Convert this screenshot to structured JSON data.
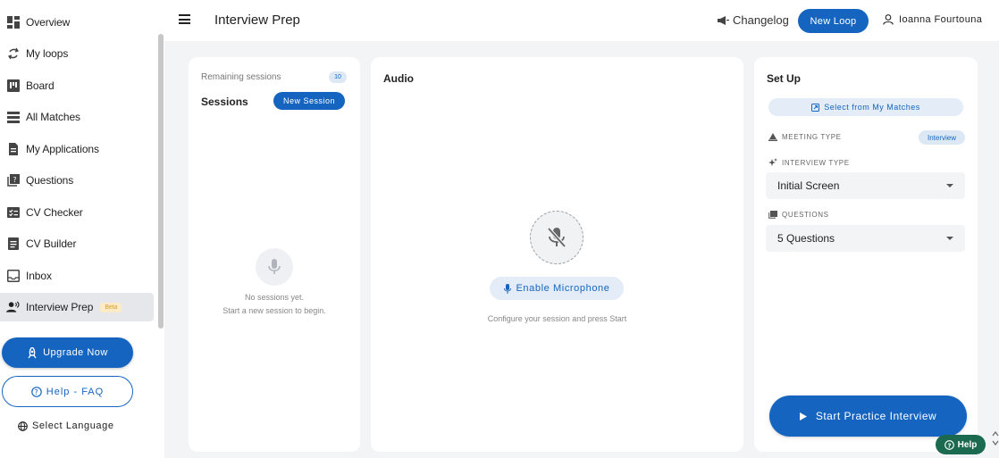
{
  "sidebar": {
    "items": [
      {
        "label": "Overview",
        "icon": "dashboard-icon"
      },
      {
        "label": "My loops",
        "icon": "loop-icon"
      },
      {
        "label": "Board",
        "icon": "board-icon"
      },
      {
        "label": "All Matches",
        "icon": "list-icon"
      },
      {
        "label": "My Applications",
        "icon": "document-icon"
      },
      {
        "label": "Questions",
        "icon": "quiz-icon"
      },
      {
        "label": "CV Checker",
        "icon": "checklist-icon"
      },
      {
        "label": "CV Builder",
        "icon": "document-icon"
      },
      {
        "label": "Inbox",
        "icon": "inbox-icon"
      },
      {
        "label": "Interview Prep",
        "icon": "person-voice-icon",
        "badge": "Beta",
        "active": true
      }
    ],
    "upgrade_label": "Upgrade Now",
    "help_label": "Help - FAQ",
    "language_label": "Select Language"
  },
  "header": {
    "title": "Interview Prep",
    "changelog_label": "Changelog",
    "new_loop_label": "New Loop",
    "user_name": "Ioanna Fourtouna"
  },
  "sessions": {
    "remaining_label": "Remaining sessions",
    "remaining_count": "10",
    "title": "Sessions",
    "new_session_label": "New Session",
    "empty_line1": "No sessions yet.",
    "empty_line2": "Start a new session to begin."
  },
  "audio": {
    "title": "Audio",
    "enable_label": "Enable Microphone",
    "hint": "Configure your session and press Start"
  },
  "setup": {
    "title": "Set Up",
    "select_matches_label": "Select from My Matches",
    "meeting_type_label": "MEETING TYPE",
    "meeting_type_value": "Interview",
    "interview_type_label": "INTERVIEW TYPE",
    "interview_type_value": "Initial Screen",
    "questions_label": "QUESTIONS",
    "questions_value": "5 Questions",
    "start_label": "Start Practice Interview"
  },
  "help_widget": {
    "label": "Help"
  },
  "colors": {
    "accent": "#1565c0",
    "help_green": "#1b6a4f",
    "beta": "#d69e2e"
  }
}
